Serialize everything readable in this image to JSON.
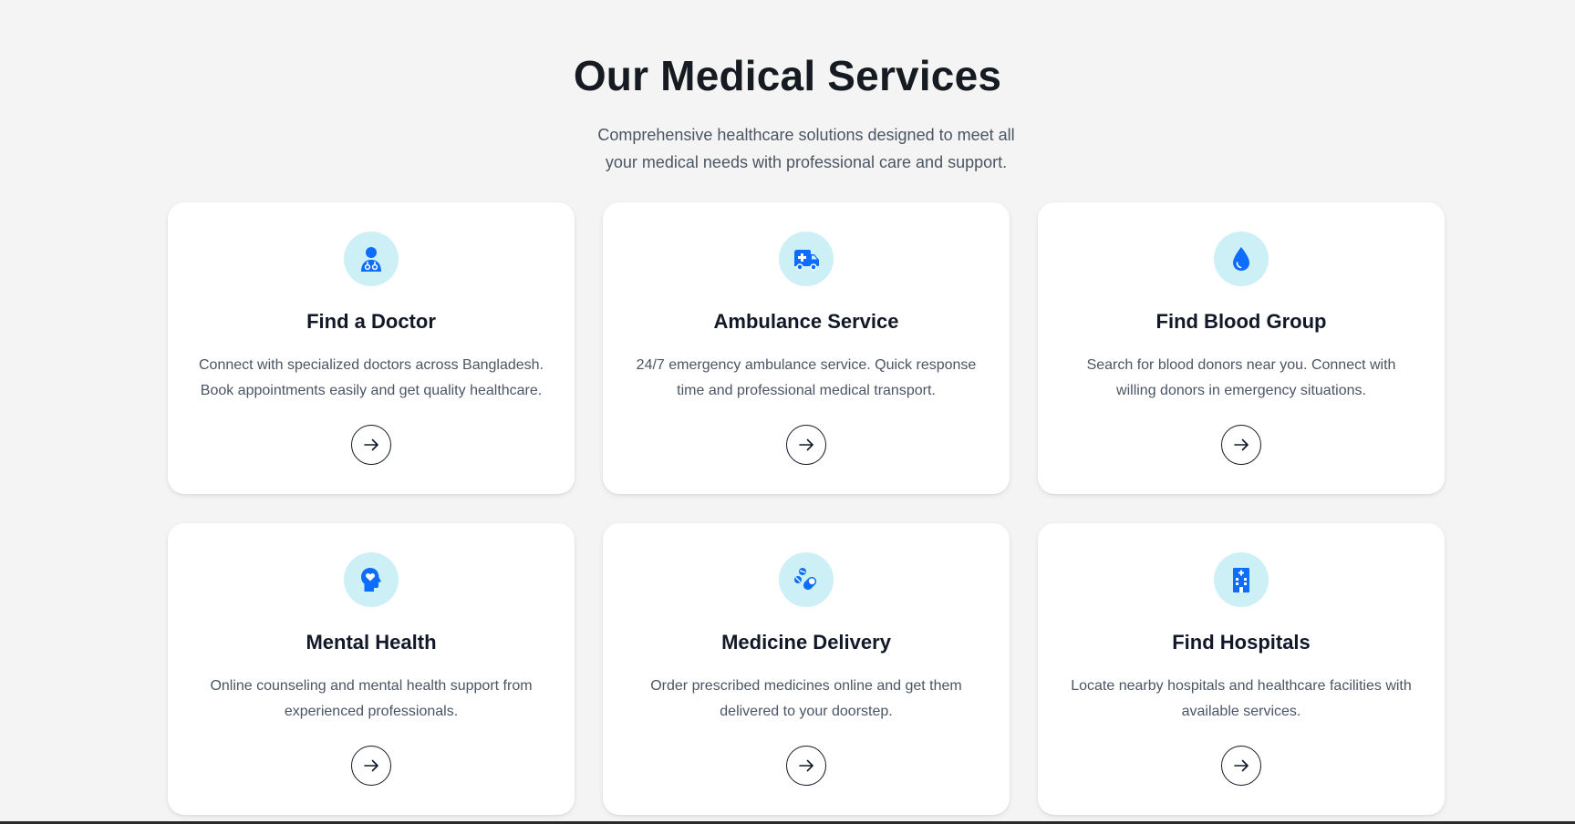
{
  "section": {
    "title": "Our Medical Services",
    "subtitle": "Comprehensive healthcare solutions designed to meet all your medical needs with professional care and support."
  },
  "services": [
    {
      "icon": "doctor-icon",
      "title": "Find a Doctor",
      "description": "Connect with specialized doctors across Bangladesh. Book appointments easily and get quality healthcare."
    },
    {
      "icon": "ambulance-icon",
      "title": "Ambulance Service",
      "description": "24/7 emergency ambulance service. Quick response time and professional medical transport."
    },
    {
      "icon": "blood-drop-icon",
      "title": "Find Blood Group",
      "description": "Search for blood donors near you. Connect with willing donors in emergency situations."
    },
    {
      "icon": "head-heart-icon",
      "title": "Mental Health",
      "description": "Online counseling and mental health support from experienced professionals."
    },
    {
      "icon": "pills-icon",
      "title": "Medicine Delivery",
      "description": "Order prescribed medicines online and get them delivered to your doorstep."
    },
    {
      "icon": "hospital-icon",
      "title": "Find Hospitals",
      "description": "Locate nearby hospitals and healthcare facilities with available services."
    }
  ],
  "colors": {
    "background": "#f4f4f4",
    "card": "#ffffff",
    "icon_bg": "#cdf0f6",
    "icon_fg": "#0d6efd",
    "title": "#111827",
    "text": "#4b5563"
  }
}
